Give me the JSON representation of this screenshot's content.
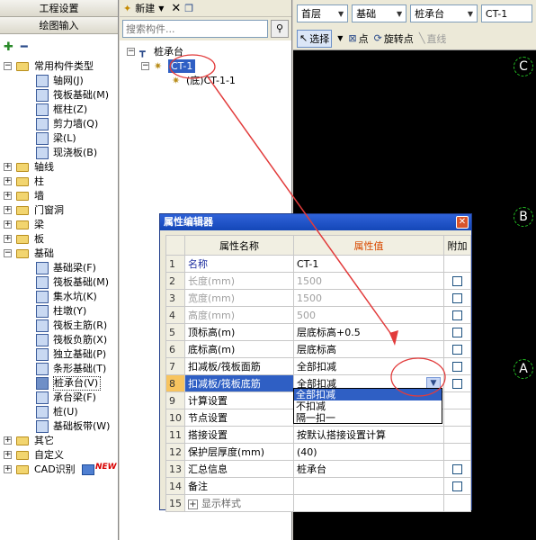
{
  "left_panel": {
    "tabs": [
      "工程设置",
      "绘图输入"
    ],
    "tree": [
      {
        "label": "常用构件类型",
        "depth": 0,
        "type": "folder",
        "expanded": true
      },
      {
        "label": "轴网(J)",
        "depth": 1,
        "type": "comp"
      },
      {
        "label": "筏板基础(M)",
        "depth": 1,
        "type": "comp"
      },
      {
        "label": "框柱(Z)",
        "depth": 1,
        "type": "comp"
      },
      {
        "label": "剪力墙(Q)",
        "depth": 1,
        "type": "comp"
      },
      {
        "label": "梁(L)",
        "depth": 1,
        "type": "comp"
      },
      {
        "label": "现浇板(B)",
        "depth": 1,
        "type": "comp"
      },
      {
        "label": "轴线",
        "depth": 0,
        "type": "folder",
        "expanded": false
      },
      {
        "label": "柱",
        "depth": 0,
        "type": "folder",
        "expanded": false
      },
      {
        "label": "墙",
        "depth": 0,
        "type": "folder",
        "expanded": false
      },
      {
        "label": "门窗洞",
        "depth": 0,
        "type": "folder",
        "expanded": false
      },
      {
        "label": "梁",
        "depth": 0,
        "type": "folder",
        "expanded": false
      },
      {
        "label": "板",
        "depth": 0,
        "type": "folder",
        "expanded": false
      },
      {
        "label": "基础",
        "depth": 0,
        "type": "folder",
        "expanded": true
      },
      {
        "label": "基础梁(F)",
        "depth": 1,
        "type": "comp"
      },
      {
        "label": "筏板基础(M)",
        "depth": 1,
        "type": "comp"
      },
      {
        "label": "集水坑(K)",
        "depth": 1,
        "type": "comp"
      },
      {
        "label": "柱墩(Y)",
        "depth": 1,
        "type": "comp"
      },
      {
        "label": "筏板主筋(R)",
        "depth": 1,
        "type": "comp"
      },
      {
        "label": "筏板负筋(X)",
        "depth": 1,
        "type": "comp"
      },
      {
        "label": "独立基础(P)",
        "depth": 1,
        "type": "comp"
      },
      {
        "label": "条形基础(T)",
        "depth": 1,
        "type": "comp"
      },
      {
        "label": "桩承台(V)",
        "depth": 1,
        "type": "comp",
        "selected": true
      },
      {
        "label": "承台梁(F)",
        "depth": 1,
        "type": "comp"
      },
      {
        "label": "桩(U)",
        "depth": 1,
        "type": "comp"
      },
      {
        "label": "基础板带(W)",
        "depth": 1,
        "type": "comp"
      },
      {
        "label": "其它",
        "depth": 0,
        "type": "folder",
        "expanded": false
      },
      {
        "label": "自定义",
        "depth": 0,
        "type": "folder",
        "expanded": false
      },
      {
        "label": "CAD识别",
        "depth": 0,
        "type": "folder",
        "expanded": false,
        "badge": "NEW"
      }
    ]
  },
  "mid_panel": {
    "new_label": "新建",
    "search_placeholder": "搜索构件...",
    "tree": [
      {
        "label": "桩承台",
        "depth": 0
      },
      {
        "label": "CT-1",
        "depth": 1,
        "selected": true
      },
      {
        "label": "(底)CT-1-1",
        "depth": 2
      }
    ]
  },
  "right_panel": {
    "floor": "首层",
    "category": "基础",
    "type": "桩承台",
    "item": "CT-1",
    "tools": {
      "select": "选择",
      "point": "点",
      "rotate_point": "旋转点",
      "line": "直线"
    },
    "axis_labels": [
      "C",
      "B",
      "A"
    ]
  },
  "dialog": {
    "title": "属性编辑器",
    "headers": {
      "name": "属性名称",
      "value": "属性值",
      "add": "附加"
    },
    "rows": [
      {
        "num": "1",
        "name": "名称",
        "value": "CT-1",
        "style": "blue",
        "checkbox": false
      },
      {
        "num": "2",
        "name": "长度(mm)",
        "value": "1500",
        "style": "grey",
        "checkbox": true
      },
      {
        "num": "3",
        "name": "宽度(mm)",
        "value": "1500",
        "style": "grey",
        "checkbox": true
      },
      {
        "num": "4",
        "name": "高度(mm)",
        "value": "500",
        "style": "grey",
        "checkbox": true
      },
      {
        "num": "5",
        "name": "顶标高(m)",
        "value": "层底标高+0.5",
        "style": "",
        "checkbox": true
      },
      {
        "num": "6",
        "name": "底标高(m)",
        "value": "层底标高",
        "style": "",
        "checkbox": true
      },
      {
        "num": "7",
        "name": "扣减板/筏板面筋",
        "value": "全部扣减",
        "style": "",
        "checkbox": true
      },
      {
        "num": "8",
        "name": "扣减板/筏板底筋",
        "value": "全部扣减",
        "style": "sel",
        "checkbox": true
      },
      {
        "num": "9",
        "name": "计算设置",
        "value": "",
        "style": "",
        "checkbox": false
      },
      {
        "num": "10",
        "name": "节点设置",
        "value": "",
        "style": "",
        "checkbox": false
      },
      {
        "num": "11",
        "name": "搭接设置",
        "value": "按默认搭接设置计算",
        "style": "",
        "checkbox": false
      },
      {
        "num": "12",
        "name": "保护层厚度(mm)",
        "value": "(40)",
        "style": "",
        "checkbox": false
      },
      {
        "num": "13",
        "name": "汇总信息",
        "value": "桩承台",
        "style": "",
        "checkbox": true
      },
      {
        "num": "14",
        "name": "备注",
        "value": "",
        "style": "",
        "checkbox": true
      },
      {
        "num": "15",
        "name": "显示样式",
        "value": "",
        "style": "expand",
        "checkbox": false
      }
    ],
    "dropdown_options": [
      "全部扣减",
      "不扣减",
      "隔一扣一"
    ]
  }
}
